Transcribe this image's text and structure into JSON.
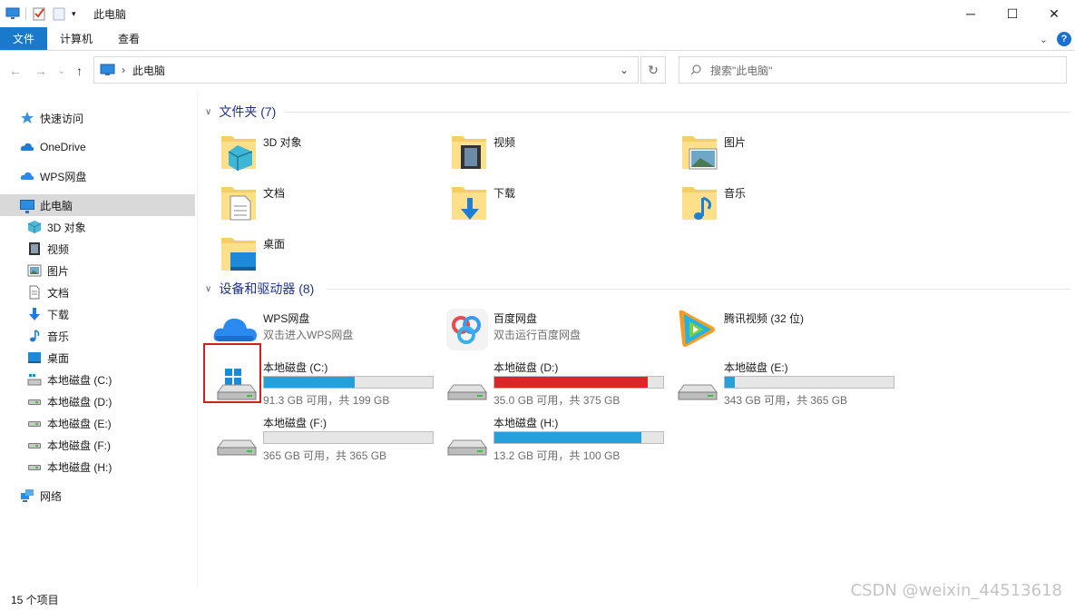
{
  "window": {
    "title": "此电脑"
  },
  "ribbon": {
    "tabs": [
      "文件",
      "计算机",
      "查看"
    ]
  },
  "address": {
    "crumbs": [
      "此电脑"
    ],
    "search_placeholder": "搜索\"此电脑\""
  },
  "sidebar": {
    "items": [
      {
        "label": "快速访问",
        "icon": "star-icon"
      },
      {
        "label": "OneDrive",
        "icon": "cloud-icon"
      },
      {
        "label": "WPS网盘",
        "icon": "wps-cloud-icon"
      },
      {
        "label": "此电脑",
        "icon": "pc-icon",
        "selected": true
      },
      {
        "label": "3D 对象",
        "icon": "3d-objects-icon"
      },
      {
        "label": "视频",
        "icon": "video-icon"
      },
      {
        "label": "图片",
        "icon": "pictures-icon"
      },
      {
        "label": "文档",
        "icon": "documents-icon"
      },
      {
        "label": "下载",
        "icon": "download-icon"
      },
      {
        "label": "音乐",
        "icon": "music-icon"
      },
      {
        "label": "桌面",
        "icon": "desktop-icon"
      },
      {
        "label": "本地磁盘 (C:)",
        "icon": "drive-icon"
      },
      {
        "label": "本地磁盘 (D:)",
        "icon": "drive-icon"
      },
      {
        "label": "本地磁盘 (E:)",
        "icon": "drive-icon"
      },
      {
        "label": "本地磁盘 (F:)",
        "icon": "drive-icon"
      },
      {
        "label": "本地磁盘 (H:)",
        "icon": "drive-icon"
      },
      {
        "label": "网络",
        "icon": "network-icon"
      }
    ]
  },
  "folders_group": {
    "header": "文件夹 (7)",
    "items": [
      {
        "label": "3D 对象",
        "icon": "3d-objects-folder-icon"
      },
      {
        "label": "视频",
        "icon": "video-folder-icon"
      },
      {
        "label": "图片",
        "icon": "pictures-folder-icon"
      },
      {
        "label": "文档",
        "icon": "documents-folder-icon"
      },
      {
        "label": "下载",
        "icon": "downloads-folder-icon"
      },
      {
        "label": "音乐",
        "icon": "music-folder-icon"
      },
      {
        "label": "桌面",
        "icon": "desktop-folder-icon"
      }
    ]
  },
  "devices_group": {
    "header": "设备和驱动器 (8)",
    "apps": [
      {
        "name": "WPS网盘",
        "sub": "双击进入WPS网盘",
        "icon": "wps-cloud-icon"
      },
      {
        "name": "百度网盘",
        "sub": "双击运行百度网盘",
        "icon": "baidu-netdisk-icon"
      },
      {
        "name": "腾讯视频 (32 位)",
        "sub": "",
        "icon": "tencent-video-icon"
      }
    ],
    "drives": [
      {
        "name": "本地磁盘 (C:)",
        "free": "91.3 GB 可用，共 199 GB",
        "used_fraction": 0.54,
        "color": "#26a0da"
      },
      {
        "name": "本地磁盘 (D:)",
        "free": "35.0 GB 可用，共 375 GB",
        "used_fraction": 0.91,
        "color": "#da2626"
      },
      {
        "name": "本地磁盘 (E:)",
        "free": "343 GB 可用，共 365 GB",
        "used_fraction": 0.06,
        "color": "#26a0da"
      },
      {
        "name": "本地磁盘 (F:)",
        "free": "365 GB 可用，共 365 GB",
        "used_fraction": 0.0,
        "color": "#26a0da"
      },
      {
        "name": "本地磁盘 (H:)",
        "free": "13.2 GB 可用，共 100 GB",
        "used_fraction": 0.87,
        "color": "#26a0da"
      }
    ]
  },
  "status": {
    "count": "15 个项目"
  },
  "watermark": "CSDN @weixin_44513618"
}
